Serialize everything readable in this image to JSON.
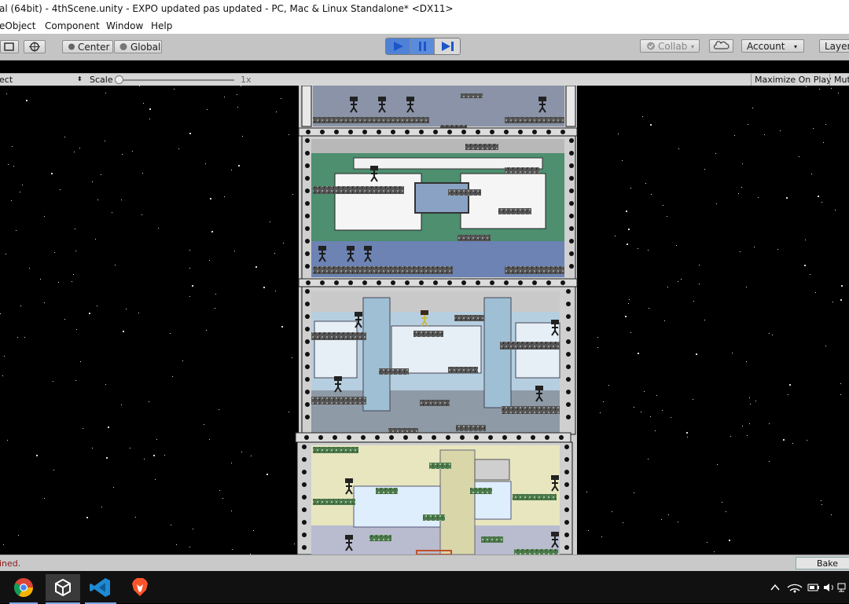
{
  "window": {
    "title": "al (64bit) - 4thScene.unity - EXPO updated pas updated - PC, Mac & Linux Standalone* <DX11>"
  },
  "menu": {
    "items": [
      "eObject",
      "Component",
      "Window",
      "Help"
    ]
  },
  "toolbar": {
    "pivot_label": "Center",
    "space_label": "Global",
    "collab_label": "Collab",
    "account_label": "Account",
    "layers_label": "Layer"
  },
  "game_view": {
    "display_label": "ect",
    "scale_label": "Scale",
    "scale_value": "1x",
    "scale_slider_fraction": 0.0,
    "maximize_label": "Maximize On Play",
    "mute_label": "Mut"
  },
  "status": {
    "message": "ined.",
    "message_color": "#8b1a1a",
    "bake_label": "Bake pa"
  },
  "taskbar": {
    "apps": [
      "chrome-icon",
      "unity-icon",
      "vscode-icon",
      "brave-icon"
    ],
    "tray": [
      "chevron-up-icon",
      "wifi-icon",
      "battery-icon",
      "volume-icon",
      "network-icon"
    ]
  },
  "colors": {
    "accent_play": "#2d6be0",
    "scene_bg": "#000000"
  }
}
